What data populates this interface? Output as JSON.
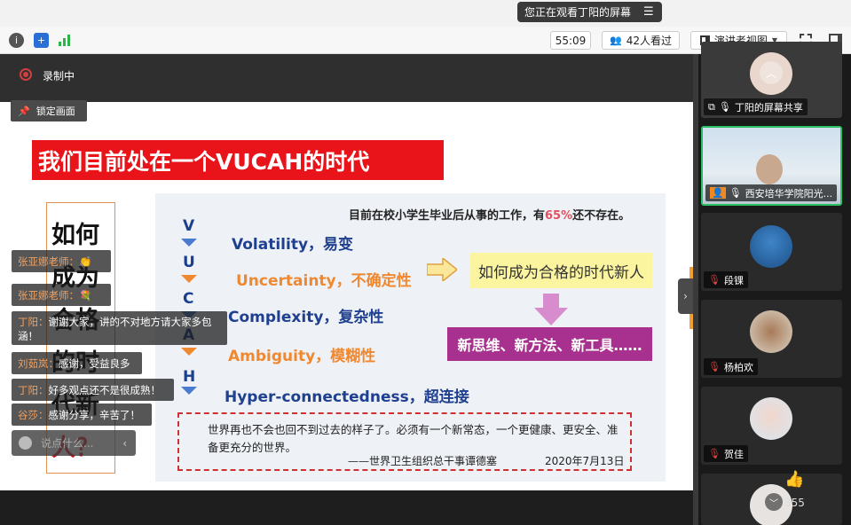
{
  "banner": {
    "text": "您正在观看丁阳的屏幕",
    "menu_icon": "list-icon"
  },
  "toolbar": {
    "timer": "55:09",
    "viewers": "42人看过",
    "view_mode": "演讲者视图"
  },
  "recording": {
    "label": "录制中"
  },
  "lock_button": {
    "label": "锁定画面"
  },
  "slide": {
    "title": "我们目前处在一个VUCAH的时代",
    "vertical_words": [
      "如何",
      "成为",
      "合格",
      "的时",
      "代新",
      "人？"
    ],
    "stat_prefix": "目前在校小学生毕业后从事的工作，有",
    "stat_pct": "65%",
    "stat_suffix": "还不存在。",
    "letters": [
      "V",
      "U",
      "C",
      "A",
      "H"
    ],
    "terms": [
      {
        "text": "Volatility，易变",
        "color": "blue"
      },
      {
        "text": "Uncertainty，不确定性",
        "color": "orange"
      },
      {
        "text": "Complexity，复杂性",
        "color": "blue"
      },
      {
        "text": "Ambiguity，模糊性",
        "color": "orange"
      },
      {
        "text": "Hyper-connectedness，超连接",
        "color": "blue"
      }
    ],
    "yellow_box": "如何成为合格的时代新人",
    "purple_box": "新思维、新方法、新工具……",
    "quote": "世界再也不会也回不到过去的样子了。必须有一个新常态，一个更健康、更安全、准备更充分的世界。",
    "quote_sign": "——世界卫生组织总干事谭德塞",
    "quote_date": "2020年7月13日"
  },
  "chat": [
    {
      "who": "张亚娜老师：",
      "text": "👏"
    },
    {
      "who": "张亚娜老师：",
      "text": "💐"
    },
    {
      "who": "丁阳：",
      "text": "谢谢大家，讲的不对地方请大家多包涵！"
    },
    {
      "who": "刘茹岚：",
      "text": "感谢，受益良多"
    },
    {
      "who": "丁阳：",
      "text": "好多观点还不是很成熟！"
    },
    {
      "who": "谷莎：",
      "text": "感谢分享，辛苦了！"
    }
  ],
  "chat_input": {
    "placeholder": "说点什么..."
  },
  "participants": [
    {
      "name": "丁阳的屏幕共享",
      "mic": "on"
    },
    {
      "name": "西安培华学院阳光...",
      "mic": "on"
    },
    {
      "name": "段锞",
      "mic": "off"
    },
    {
      "name": "杨柏欢",
      "mic": "off"
    },
    {
      "name": "贺佳",
      "mic": "off"
    }
  ],
  "like_count": "355",
  "colors": {
    "accent_green": "#28c060",
    "title_red": "#e8141a",
    "purple": "#a8318f"
  }
}
